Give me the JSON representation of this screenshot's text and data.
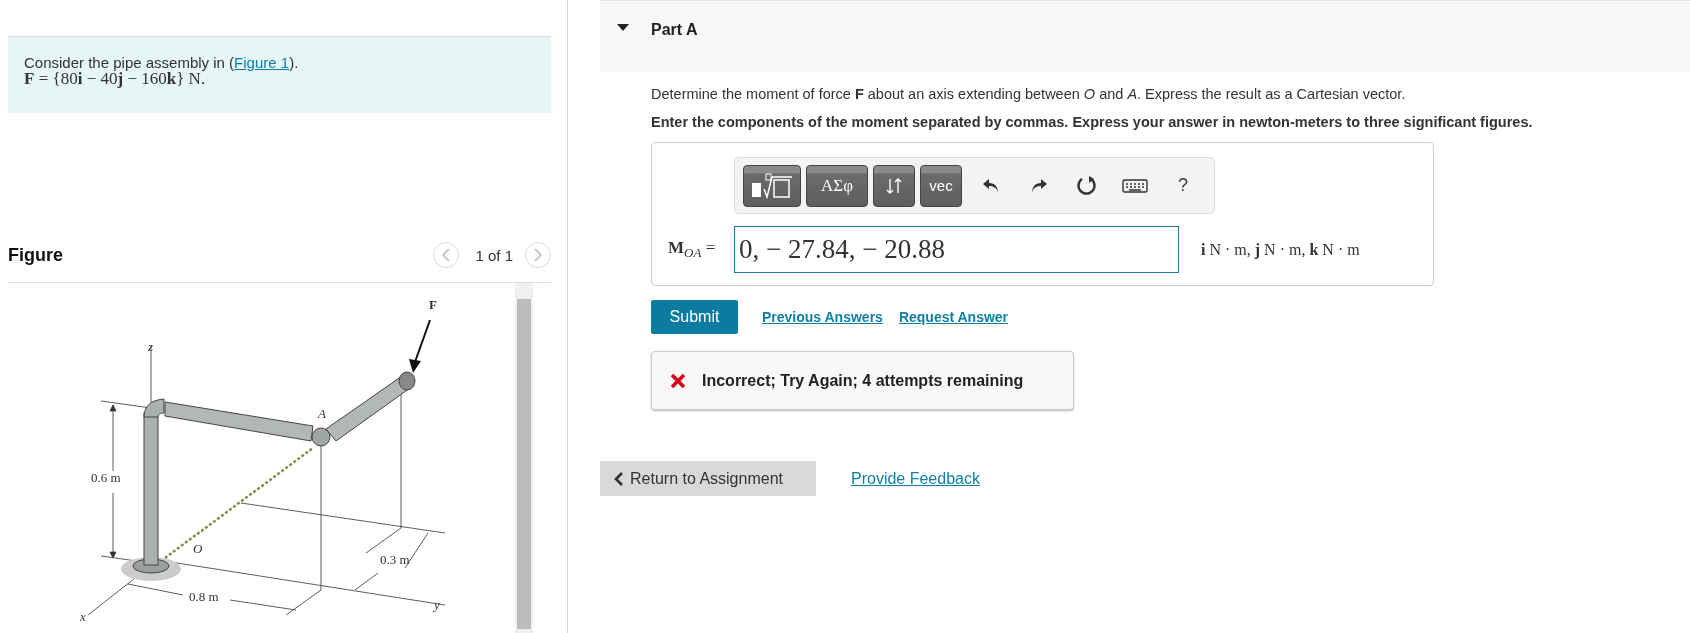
{
  "problem": {
    "intro": "Consider the pipe assembly in (",
    "link": "Figure 1",
    "after": ").",
    "formula": "**F** = {80**i** − 40**j** − 160**k**} N."
  },
  "figure_panel": {
    "title": "Figure",
    "pager": "1 of 1",
    "prev_disabled": true,
    "next_disabled": true,
    "labels": [
      {
        "kind": "z",
        "text": "z"
      },
      {
        "kind": "F",
        "text": "F"
      },
      {
        "kind": "A",
        "text": "A"
      },
      {
        "kind": "h",
        "text": "0.6 m"
      },
      {
        "kind": "O",
        "text": "O"
      },
      {
        "kind": "d",
        "text": "0.3 m"
      },
      {
        "kind": "w",
        "text": "0.8 m"
      },
      {
        "kind": "x",
        "text": "x"
      },
      {
        "kind": "y",
        "text": "y"
      }
    ]
  },
  "part": {
    "title": "Part A",
    "expanded": true,
    "question": "Determine the moment of force **F** about an axis extending between *O* and *A*. Express the result as a Cartesian vector.",
    "instruction": "Enter the components of the moment separated by commas. Express your answer in newton-meters to three significant figures.",
    "toolbar": [
      {
        "kind": "template"
      },
      {
        "kind": "text",
        "label": "ΑΣφ"
      },
      {
        "kind": "arrows"
      },
      {
        "kind": "text",
        "label": "vec"
      },
      {
        "kind": "undo"
      },
      {
        "kind": "redo"
      },
      {
        "kind": "reset"
      },
      {
        "kind": "keyboard"
      },
      {
        "kind": "help",
        "label": "?"
      }
    ],
    "answer_label": "**M**$_{OA}$ =",
    "answer_value": "0, − 27.84, − 20.88",
    "units": "**i** N · m, **j** N · m, **k** N · m",
    "submit": "Submit",
    "links": [
      "Previous Answers",
      "Request Answer"
    ],
    "feedback": {
      "correct": false,
      "text": "Incorrect; Try Again; 4 attempts remaining"
    }
  },
  "footer": {
    "return": "Return to Assignment",
    "feedback_link": "Provide Feedback"
  }
}
